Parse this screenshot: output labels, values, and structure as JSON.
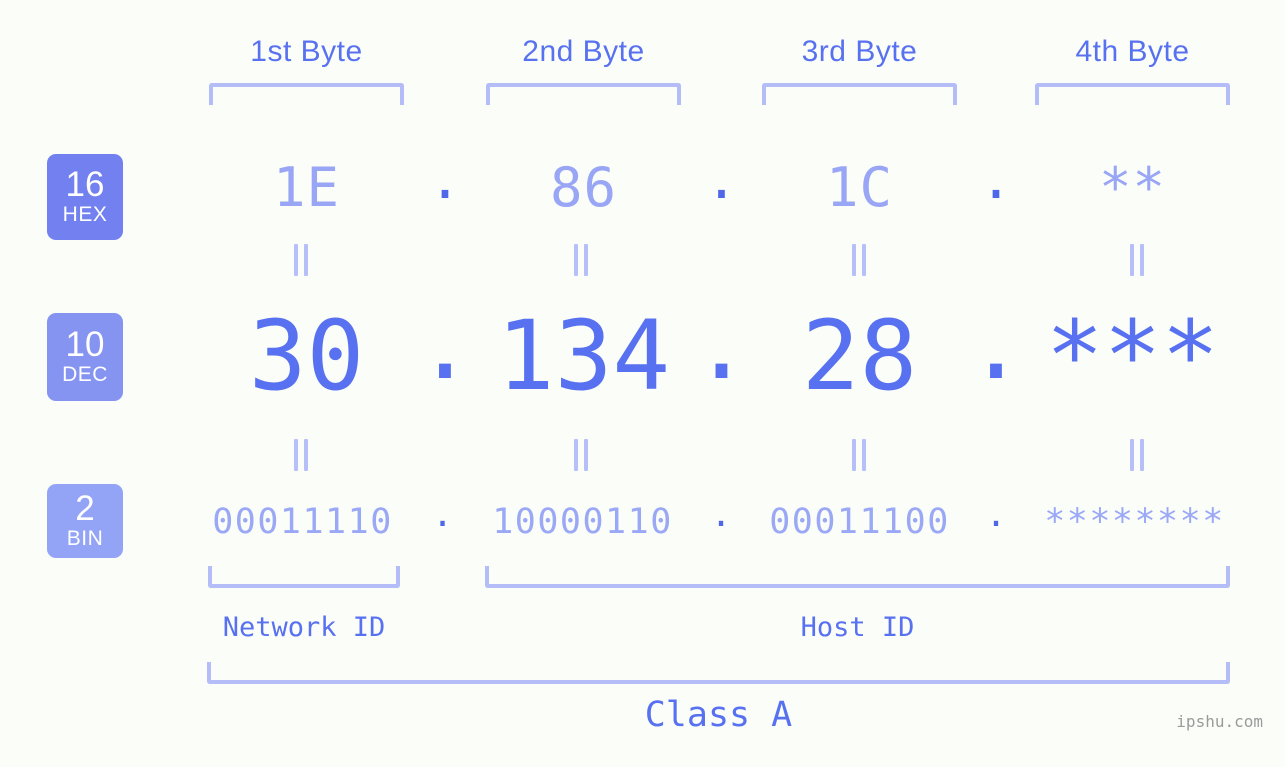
{
  "meta": {
    "background_color": "#fbfdf8",
    "accent_color": "#5871f0",
    "accent_light": "#98a6f5",
    "bracket_color": "#b4bdf7",
    "watermark": "ipshu.com"
  },
  "byte_headers": [
    {
      "label": "1st Byte"
    },
    {
      "label": "2nd Byte"
    },
    {
      "label": "3rd Byte"
    },
    {
      "label": "4th Byte"
    }
  ],
  "bases": [
    {
      "number": "16",
      "name": "HEX",
      "badge_color": "#7281ef"
    },
    {
      "number": "10",
      "name": "DEC",
      "badge_color": "#8593f1"
    },
    {
      "number": "2",
      "name": "BIN",
      "badge_color": "#93a4f7"
    }
  ],
  "rows": {
    "hex": {
      "base_number": "16",
      "base_name": "HEX",
      "values": [
        "1E",
        "86",
        "1C",
        "**"
      ],
      "separator": "."
    },
    "dec": {
      "base_number": "10",
      "base_name": "DEC",
      "values": [
        "30",
        "134",
        "28",
        "***"
      ],
      "separator": "."
    },
    "bin": {
      "base_number": "2",
      "base_name": "BIN",
      "values": [
        "00011110",
        "10000110",
        "00011100",
        "********"
      ],
      "separator": "."
    }
  },
  "equality_marks": {
    "glyph": "||",
    "hex_to_dec_count": 4,
    "dec_to_bin_count": 4
  },
  "sections": [
    {
      "label": "Network ID"
    },
    {
      "label": "Host ID"
    }
  ],
  "class": {
    "label": "Class A"
  }
}
